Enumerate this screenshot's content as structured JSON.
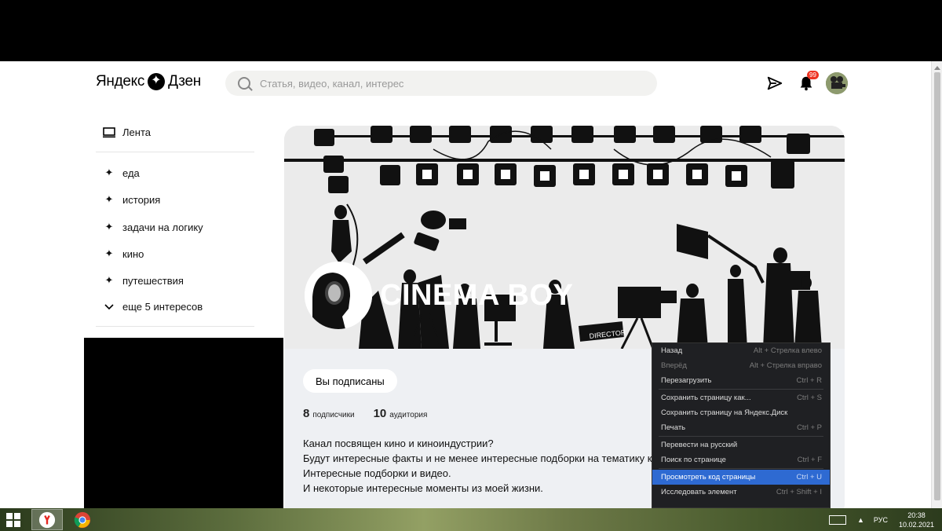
{
  "header": {
    "logo_left": "Яндекс",
    "logo_right": "Дзен",
    "search_placeholder": "Статья, видео, канал, интерес",
    "notification_count": "99"
  },
  "sidebar": {
    "feed_label": "Лента",
    "interests": [
      "еда",
      "история",
      "задачи на логику",
      "кино",
      "путешествия"
    ],
    "more_label": "еще 5 интересов"
  },
  "channel": {
    "title": "CINEMA BOY",
    "cover_sign": "DIRECTOR",
    "subscribe_label": "Вы подписаны",
    "subscribers_count": "8",
    "subscribers_label": "подписчики",
    "audience_count": "10",
    "audience_label": "аудитория",
    "description": [
      "Канал посвящен кино и киноиндустрии?",
      "Будут интересные факты и не менее интересные подборки на тематику кино",
      "Интересные подборки и видео.",
      "И некоторые интересные моменты из моей жизни."
    ]
  },
  "context_menu": {
    "items": [
      {
        "label": "Назад",
        "shortcut": "Alt + Стрелка влево"
      },
      {
        "label": "Вперёд",
        "shortcut": "Alt + Стрелка вправо",
        "disabled": true
      },
      {
        "label": "Перезагрузить",
        "shortcut": "Ctrl + R"
      },
      {
        "label": "Сохранить страницу как...",
        "shortcut": "Ctrl + S"
      },
      {
        "label": "Сохранить страницу на Яндекс.Диск",
        "shortcut": ""
      },
      {
        "label": "Печать",
        "shortcut": "Ctrl + P"
      },
      {
        "label": "Перевести на русский",
        "shortcut": ""
      },
      {
        "label": "Поиск по странице",
        "shortcut": "Ctrl + F"
      },
      {
        "label": "Просмотреть код страницы",
        "shortcut": "Ctrl + U",
        "active": true
      },
      {
        "label": "Исследовать элемент",
        "shortcut": "Ctrl + Shift + I"
      }
    ]
  },
  "taskbar": {
    "language": "РУС",
    "time": "20:38",
    "date": "10.02.2021"
  }
}
